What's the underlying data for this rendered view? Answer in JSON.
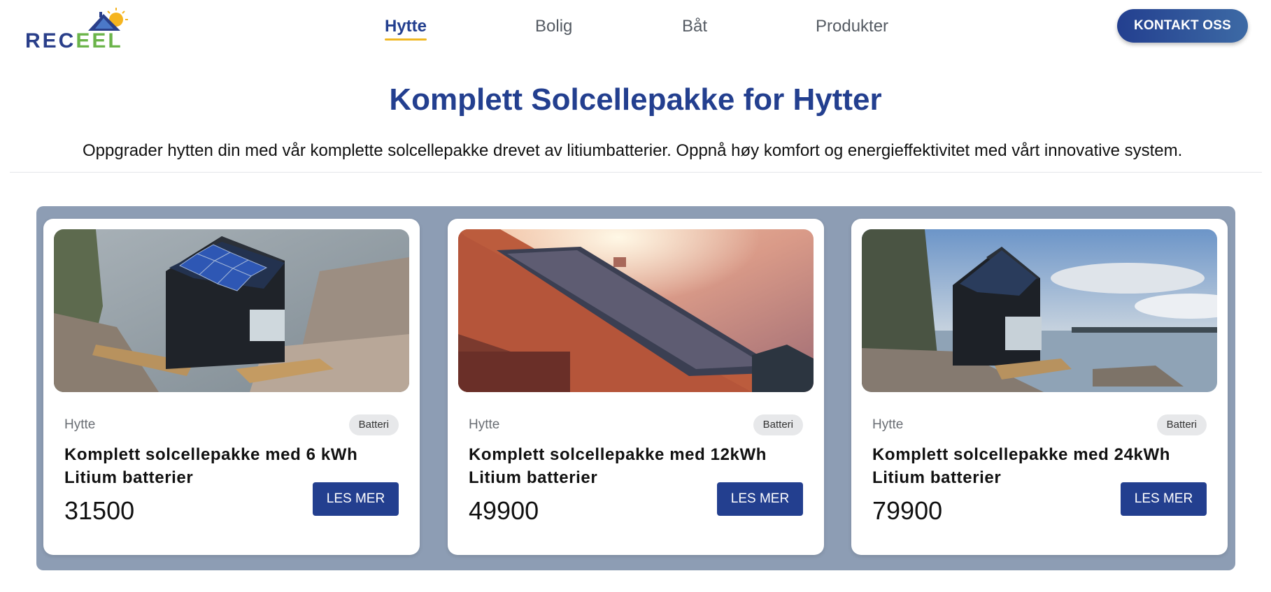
{
  "brand": {
    "logo_text_part1": "REC",
    "logo_text_part2": "EEL",
    "primary_color": "#233f8f",
    "accent_color": "#f0b722",
    "green_color": "#6bb44a"
  },
  "nav": {
    "items": [
      {
        "label": "Hytte",
        "active": true
      },
      {
        "label": "Bolig",
        "active": false
      },
      {
        "label": "Båt",
        "active": false
      },
      {
        "label": "Produkter",
        "active": false
      }
    ],
    "contact_label": "KONTAKT OSS"
  },
  "hero": {
    "title": "Komplett Solcellepakke for Hytter",
    "subtitle": "Oppgrader hytten din med vår komplette solcellepakke drevet av litiumbatterier. Oppnå høy komfort og energieffektivitet med vårt innovative system."
  },
  "products": [
    {
      "category": "Hytte",
      "badge": "Batteri",
      "title": "Komplett solcellepakke med 6 kWh Litium batterier",
      "price": "31500",
      "button": "LES MER",
      "image": "black-cabin-with-solar-panels-on-rocky-shore"
    },
    {
      "category": "Hytte",
      "badge": "Batteri",
      "title": "Komplett solcellepakke med 12kWh Litium batterier",
      "price": "49900",
      "button": "LES MER",
      "image": "tiled-roof-with-solar-panels-at-sunset"
    },
    {
      "category": "Hytte",
      "badge": "Batteri",
      "title": "Komplett solcellepakke med 24kWh Litium batterier",
      "price": "79900",
      "button": "LES MER",
      "image": "black-cabin-by-lake-under-cloudy-sky"
    }
  ]
}
